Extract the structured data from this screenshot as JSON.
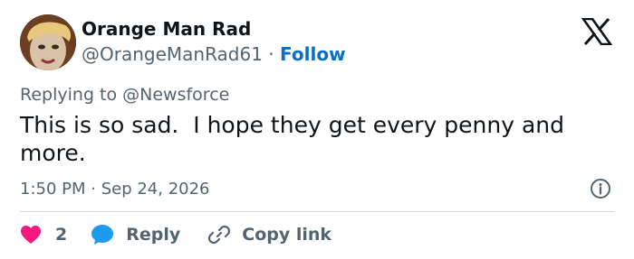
{
  "author": {
    "name": "Orange Man Rad",
    "handle": "@OrangeManRad61",
    "separator": " · ",
    "follow_label": "Follow"
  },
  "reply_context": {
    "prefix": "Replying to ",
    "mention": "@Newsforce"
  },
  "tweet": {
    "text": "This is so sad.  I hope they get every penny and more.",
    "time": "1:50 PM",
    "separator": " · ",
    "date": "Sep 24, 2026"
  },
  "actions": {
    "like_count": "2",
    "reply_label": "Reply",
    "copy_link_label": "Copy link"
  },
  "icons": {
    "logo": "x-logo-icon",
    "info": "info-icon",
    "like": "heart-icon",
    "reply": "speech-bubble-icon",
    "copy": "link-icon"
  },
  "colors": {
    "text": "#0f1419",
    "secondary": "#536471",
    "follow": "#0a6fc9",
    "like": "#f91880",
    "reply": "#1d9bf0",
    "divider": "#cfd9de"
  }
}
